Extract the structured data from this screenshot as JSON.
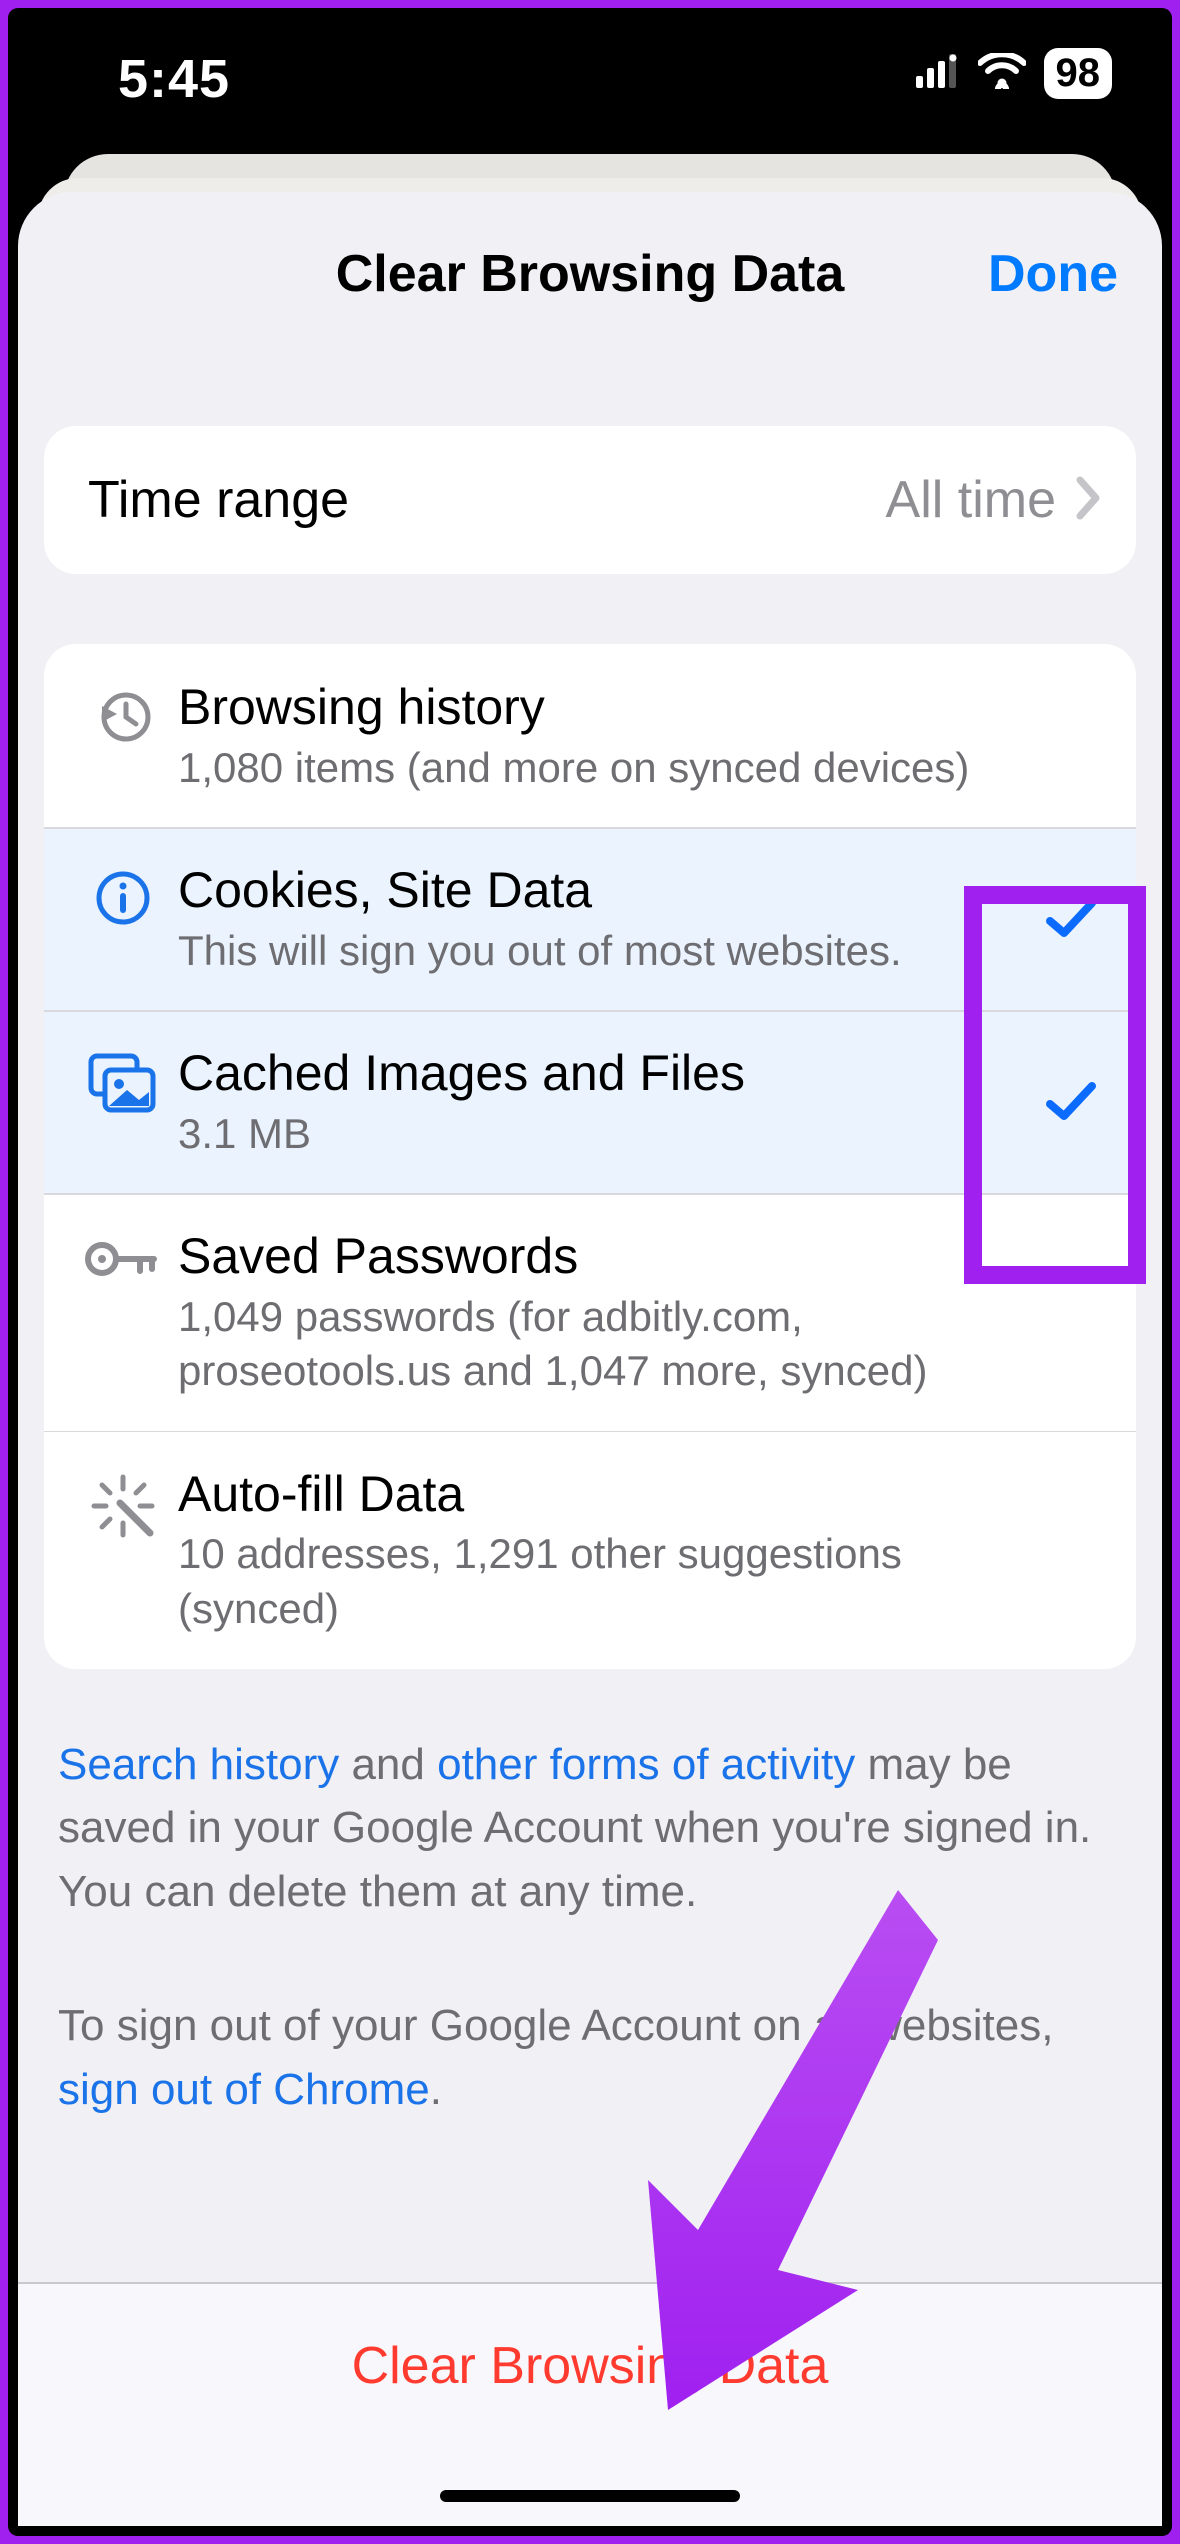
{
  "status": {
    "time": "5:45",
    "battery": "98"
  },
  "header": {
    "title": "Clear Browsing Data",
    "done": "Done"
  },
  "time_range": {
    "label": "Time range",
    "value": "All time"
  },
  "items": [
    {
      "title": "Browsing history",
      "sub": "1,080 items (and more on synced devices)",
      "selected": false,
      "checked": false,
      "icon": "history"
    },
    {
      "title": "Cookies, Site Data",
      "sub": "This will sign you out of most websites.",
      "selected": true,
      "checked": true,
      "icon": "info"
    },
    {
      "title": "Cached Images and Files",
      "sub": "3.1 MB",
      "selected": true,
      "checked": true,
      "icon": "images"
    },
    {
      "title": "Saved Passwords",
      "sub": "1,049 passwords (for adbitly.com, proseotools.us and 1,047 more, synced)",
      "selected": false,
      "checked": false,
      "icon": "key"
    },
    {
      "title": "Auto-fill Data",
      "sub": "10 addresses, 1,291 other suggestions (synced)",
      "selected": false,
      "checked": false,
      "icon": "wand"
    }
  ],
  "footer": {
    "link1": "Search history",
    "mid1": " and ",
    "link2": "other forms of activity",
    "rest1": " may be saved in your Google Account when you're signed in. You can delete them at any time.",
    "pre2": "To sign out of your Google Account on all websites, ",
    "link3": "sign out of Chrome",
    "dot": "."
  },
  "action": {
    "clear": "Clear Browsing Data"
  }
}
